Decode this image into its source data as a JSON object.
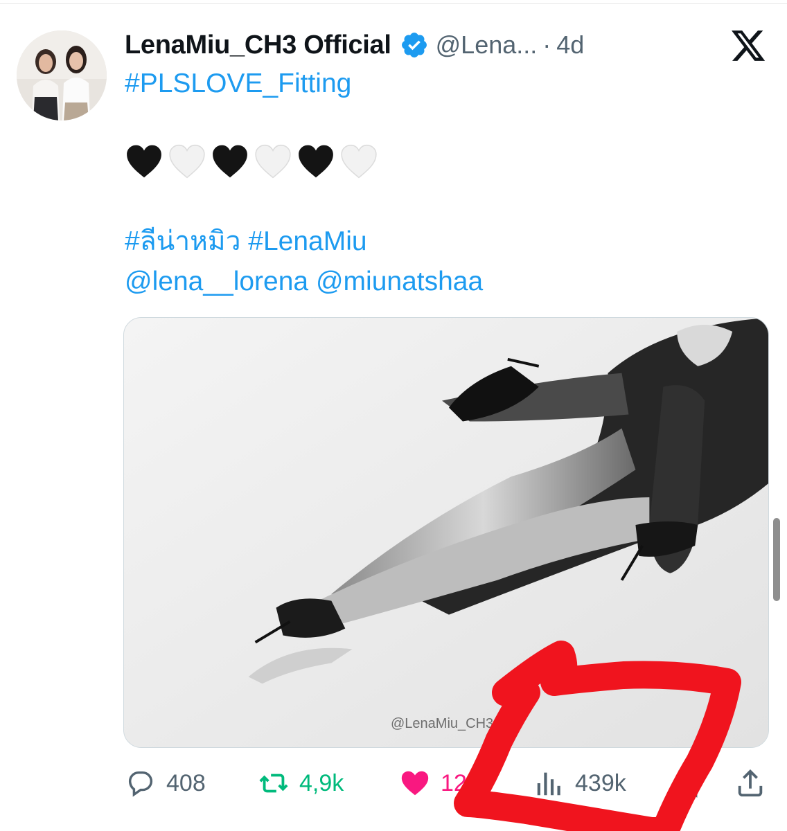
{
  "tweet": {
    "display_name": "LenaMiu_CH3 Official",
    "handle": "@Lena...",
    "dot": "·",
    "time": "4d",
    "hashtag_line1": "#PLSLOVE_Fitting",
    "hearts": [
      "black-heart",
      "white-heart",
      "black-heart",
      "white-heart",
      "black-heart",
      "white-heart"
    ],
    "hashtags_line2": "#ลีน่าหมิว #LenaMiu",
    "mentions": "@lena__lorena @miunatshaa",
    "media_watermark": "@LenaMiu_CH3OA"
  },
  "actions": {
    "reply_count": "408",
    "repost_count": "4,9k",
    "like_count": "12.",
    "views_count": "439k"
  },
  "icons": {
    "verified": "verified-badge-icon",
    "platform": "x-logo-icon",
    "reply": "reply-icon",
    "repost": "repost-icon",
    "like": "heart-icon",
    "views": "views-icon",
    "bookmark": "bookmark-icon",
    "share": "share-icon"
  },
  "colors": {
    "link_blue": "#1d9bf0",
    "repost_green": "#00ba7c",
    "like_pink": "#f91880",
    "annotation_red": "#f0141e",
    "muted_gray": "#536471"
  }
}
